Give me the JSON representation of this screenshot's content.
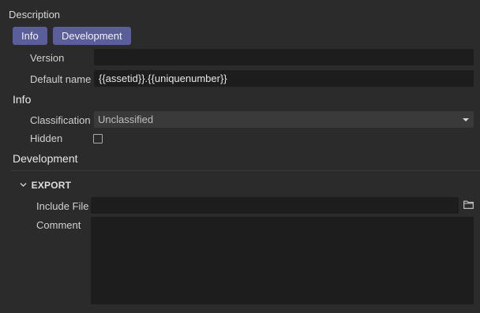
{
  "panel": {
    "title": "Description"
  },
  "tabs": [
    {
      "label": "Info"
    },
    {
      "label": "Development"
    }
  ],
  "general": {
    "version_label": "Version",
    "version_value": "",
    "default_name_label": "Default name",
    "default_name_value": "{{assetid}}.{{uniquenumber}}"
  },
  "info": {
    "heading": "Info",
    "classification_label": "Classification",
    "classification_value": "Unclassified",
    "hidden_label": "Hidden",
    "hidden_checked": false
  },
  "development": {
    "heading": "Development",
    "export": {
      "title": "EXPORT",
      "include_file_label": "Include File",
      "include_file_value": "",
      "comment_label": "Comment",
      "comment_value": ""
    }
  },
  "icons": {
    "export_toggle": "chevron-down-icon",
    "browse": "folder-icon",
    "dropdown": "caret-down-icon"
  },
  "colors": {
    "background": "#2b2b2b",
    "tab_accent": "#5a5f9c",
    "field_bg": "#1d1d1d",
    "select_bg": "#3a3a3a"
  }
}
